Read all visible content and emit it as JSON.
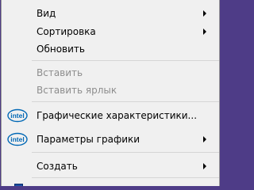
{
  "context_menu": {
    "items": [
      {
        "label": "Вид",
        "disabled": false,
        "has_submenu": true,
        "icon": null
      },
      {
        "label": "Сортировка",
        "disabled": false,
        "has_submenu": true,
        "icon": null
      },
      {
        "label": "Обновить",
        "disabled": false,
        "has_submenu": false,
        "icon": null
      },
      {
        "label": "Вставить",
        "disabled": true,
        "has_submenu": false,
        "icon": null
      },
      {
        "label": "Вставить ярлык",
        "disabled": true,
        "has_submenu": false,
        "icon": null
      },
      {
        "label": "Графические характеристики...",
        "disabled": false,
        "has_submenu": false,
        "icon": "intel-logo-icon"
      },
      {
        "label": "Параметры графики",
        "disabled": false,
        "has_submenu": true,
        "icon": "intel-logo-icon"
      },
      {
        "label": "Создать",
        "disabled": false,
        "has_submenu": true,
        "icon": null
      },
      {
        "label": "",
        "disabled": false,
        "has_submenu": false,
        "icon": "display-settings-icon"
      }
    ],
    "intel_logo_text": "intel"
  },
  "colors": {
    "desktop_background": "#4e3c87",
    "menu_background": "#f0f0f0",
    "separator": "#d5d5d5",
    "disabled_text": "#8d8d8d",
    "intel_blue": "#0068b5"
  }
}
